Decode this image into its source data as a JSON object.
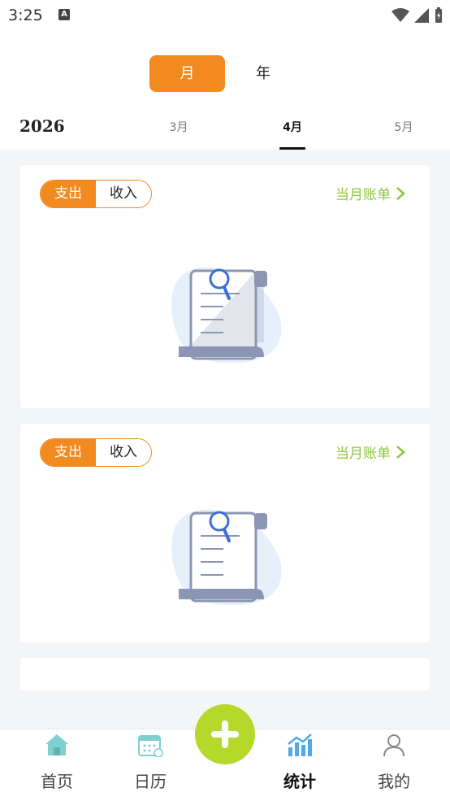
{
  "status_bar": {
    "time": "3:25",
    "icons": [
      "a-icon",
      "wifi-icon",
      "signal-icon",
      "battery-icon"
    ]
  },
  "period_switch": {
    "month": "月",
    "year": "年"
  },
  "year_label": "2026",
  "month_tabs": [
    {
      "label": "3月"
    },
    {
      "label": "4月"
    },
    {
      "label": "5月"
    }
  ],
  "cards": [
    {
      "toggle_expense": "支出",
      "toggle_income": "收入",
      "bill_link": "当月账单"
    },
    {
      "toggle_expense": "支出",
      "toggle_income": "收入",
      "bill_link": "当月账单"
    }
  ],
  "bottom_nav": [
    {
      "label": "首页",
      "icon": "home-icon"
    },
    {
      "label": "日历",
      "icon": "calendar-icon"
    },
    {
      "label": "统计",
      "icon": "stats-icon",
      "active": true
    },
    {
      "label": "我的",
      "icon": "user-icon"
    }
  ],
  "colors": {
    "accent": "#f28a1f",
    "link": "#8dc63f",
    "fab": "#b5d82a",
    "nav_teal": "#7fcfcf",
    "nav_blue": "#4ea9e6"
  }
}
